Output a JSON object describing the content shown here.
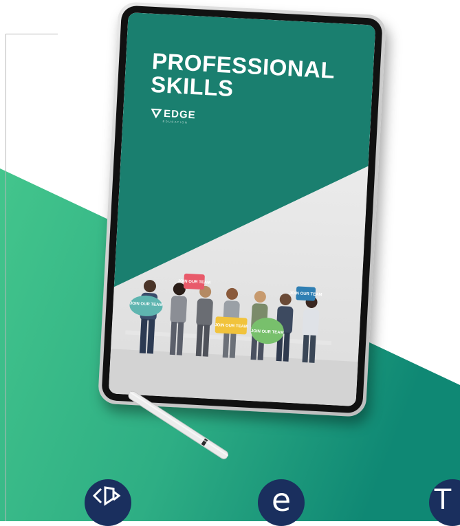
{
  "cover": {
    "title_line1": "PROFESSIONAL",
    "title_line2": "SKILLS",
    "brand": "EDGE",
    "brand_sub": "EDUCATION"
  },
  "signs": {
    "sign1": "JOIN OUR TEAM",
    "sign2": "JOIN OUR TEAM",
    "sign3": "JOIN OUR TEAM",
    "sign4": "JOIN OUR TEAM",
    "sign5": "JOIN OUR TEAM"
  },
  "bottom_icons": [
    {
      "name": "bookmark-arrows-icon"
    },
    {
      "name": "e-letter-icon",
      "glyph": "e"
    },
    {
      "name": "t-letter-icon",
      "glyph": "T"
    }
  ],
  "colors": {
    "green_light": "#3cbf86",
    "green_dark": "#158a74",
    "cover_teal": "#1a7f6f",
    "icon_navy": "#1a2f5e"
  }
}
